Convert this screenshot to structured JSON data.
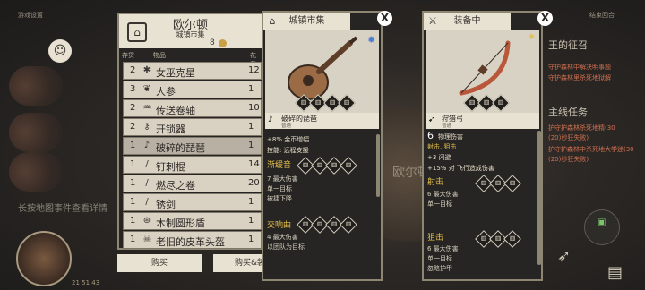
{
  "background": {
    "top_left": "游戏设置",
    "top_right": "结束回合",
    "city_label": "欧尔顿",
    "hint": "长按地图事件查看详情",
    "stats": "21   51   43",
    "quests": [
      "王的征召",
      "守护森林中解决明事题",
      "守护森林里杀死地狱解",
      "主线任务",
      "护守护森林杀死地精(30",
      "(20)秒狂失败)",
      "护守护森林中杀死地大学迷(30",
      "(20)秒狂失败)"
    ]
  },
  "shop": {
    "title": "欧尔顿",
    "subtitle": "城镇市集",
    "gold": "8",
    "col_stock": "存货",
    "col_item": "物品",
    "col_price": "花费",
    "items": [
      {
        "qty": "2",
        "icon": "✱",
        "name": "女巫克星",
        "price": "12"
      },
      {
        "qty": "3",
        "icon": "❦",
        "name": "人参",
        "price": "1"
      },
      {
        "qty": "2",
        "icon": "♒",
        "name": "传送卷轴",
        "price": "10"
      },
      {
        "qty": "2",
        "icon": "⚷",
        "name": "开锁器",
        "price": "1"
      },
      {
        "qty": "1",
        "icon": "♪",
        "name": "破碎的琵琶",
        "price": "1"
      },
      {
        "qty": "1",
        "icon": "/",
        "name": "钉刺棍",
        "price": "14"
      },
      {
        "qty": "1",
        "icon": "/",
        "name": "燃尽之卷",
        "price": "20"
      },
      {
        "qty": "1",
        "icon": "/",
        "name": "锈剑",
        "price": "1"
      },
      {
        "qty": "1",
        "icon": "⊛",
        "name": "木制圆形盾",
        "price": "1"
      },
      {
        "qty": "1",
        "icon": "☠",
        "name": "老旧的皮革头盔",
        "price": "1"
      }
    ],
    "buy_label": "购买",
    "buy_equip_label": "购买&装备"
  },
  "card_market": {
    "tab": "城镇市集",
    "close": "X",
    "name": "破碎的琵琶",
    "tag": "普通",
    "dice_row": [
      "⚅",
      "⚅",
      "⚅",
      "⚅"
    ],
    "line1": "+8% 金币增幅",
    "line2": "技能: 远程支援",
    "skill1_title": "渐缓音",
    "skill1_dice": [
      "⚅",
      "⚅",
      "⚅",
      "⚅"
    ],
    "skill1_l1": "7 最大伤害",
    "skill1_l2": "单一目标",
    "skill1_l3": "被捷下降",
    "skill2_title": "交响曲",
    "skill2_dice": [
      "⚅",
      "⚅",
      "⚅",
      "⚅"
    ],
    "skill2_l1": "4 最大伤害",
    "skill2_l2": "以团队为目标"
  },
  "card_equipped": {
    "tab": "装备中",
    "close": "X",
    "name": "狩猎弓",
    "tag": "普通",
    "dice_row": [
      "⚅",
      "⚅",
      "⚅"
    ],
    "dmg_num": "6",
    "dmg_label": "物理伤害",
    "skills_line": "射击, 狙击",
    "line_dodge": "+3 闪避",
    "line_fly": "+15% 对 飞行造成伤害",
    "skill1_title": "射击",
    "skill1_dice": [
      "⚅",
      "⚅",
      "⚅"
    ],
    "skill1_l1": "6 最大伤害",
    "skill1_l2": "单一目标",
    "skill2_title": "狙击",
    "skill2_dice": [
      "⚅",
      "⚅",
      "⚅"
    ],
    "skill2_l1": "6 最大伤害",
    "skill2_l2": "单一目标",
    "skill2_l3": "忽略护甲"
  }
}
